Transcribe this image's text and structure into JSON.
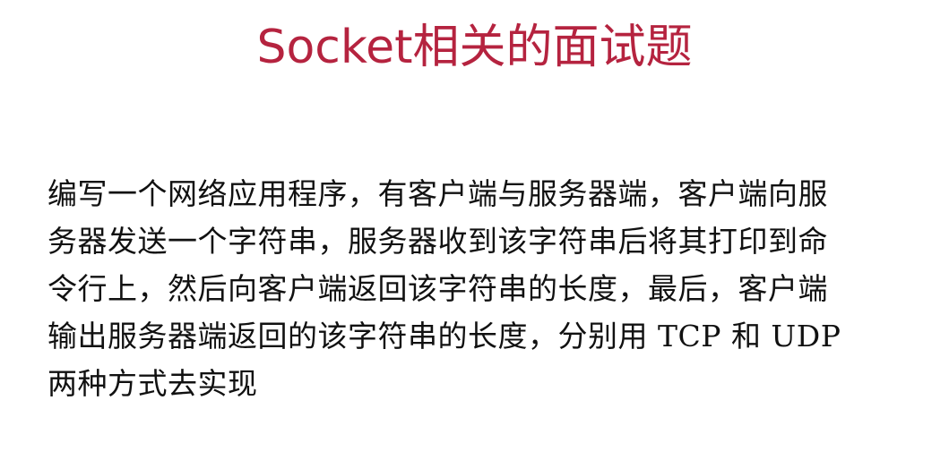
{
  "slide": {
    "title": "Socket相关的面试题",
    "lines": [
      "编写一个网络应用程序，有客户端与服务器端，客户端向服",
      "务器发送一个字符串，服务器收到该字符串后将其打印到命",
      "令行上，然后向客户端返回该字符串的长度，最后，客户端",
      "输出服务器端返回的该字符串的长度，分别用 TCP 和 UDP",
      "两种方式去实现"
    ],
    "colors": {
      "title": "#b5233f",
      "text": "#111111",
      "background": "#ffffff"
    }
  }
}
